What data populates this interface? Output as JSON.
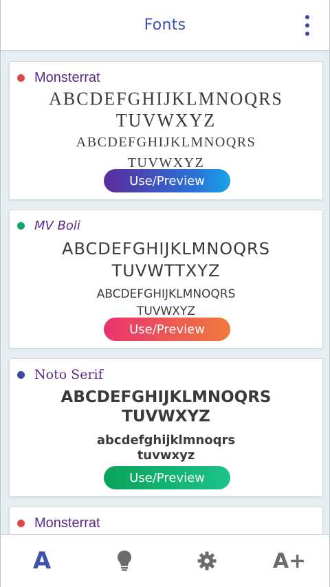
{
  "topbar": {
    "title": "Fonts",
    "menu_icon": "kebab-menu-icon"
  },
  "cards": [
    {
      "name": "Monsterrat",
      "dot_color": "#e0464f",
      "upper_line1": "ABCDEFGHIJKLMNOQRS",
      "upper_line2": "TUVWXYZ",
      "lower_line1": "ABCDEFGHIJKLMNOQRS",
      "lower_line2": "TUVWXYZ",
      "button": "Use/Preview"
    },
    {
      "name": "MV Boli",
      "dot_color": "#13a36b",
      "upper_line1": "ABCDEFGHIJKLMNOQRS",
      "upper_line2": "TUVWTTXYZ",
      "lower_line1": "ABCDEFGHIJKLMNOQRS",
      "lower_line2": "TUVWXYZ",
      "button": "Use/Preview"
    },
    {
      "name": "Noto Serif",
      "dot_color": "#3848a8",
      "upper_line1": "ABCDEFGHIJKLMNOQRS",
      "upper_line2": "TUVWXYZ",
      "lower_line1": "abcdefghijklmnoqrs",
      "lower_line2": "tuvwxyz",
      "button": "Use/Preview"
    },
    {
      "name": "Monsterrat",
      "dot_color": "#e0464f"
    }
  ],
  "bottom_nav": {
    "fonts_label": "A",
    "size_label": "A+",
    "icons": [
      "font-icon",
      "lightbulb-icon",
      "gear-icon",
      "font-size-icon"
    ]
  }
}
